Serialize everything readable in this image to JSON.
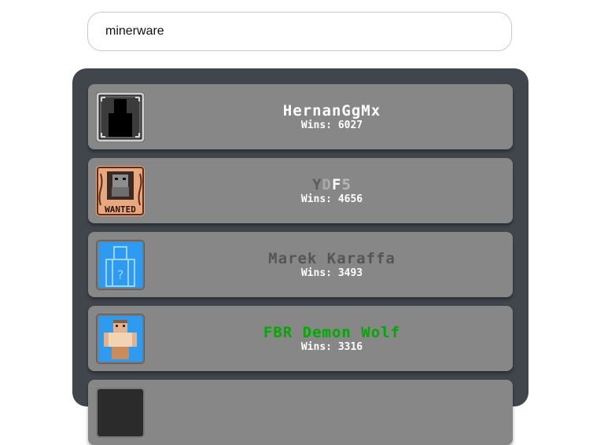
{
  "search": {
    "value": "minerware"
  },
  "players": [
    {
      "name": "HernanGgMx",
      "wins_label": "Wins: 6027",
      "name_color": "#ffffff",
      "avatar": "dark-frame-icon"
    },
    {
      "name_parts": [
        {
          "text": "Y",
          "color": "#5b5b5b"
        },
        {
          "text": "D",
          "color": "#aaaaaa"
        },
        {
          "text": "F",
          "color": "#ffffff"
        },
        {
          "text": "5",
          "color": "#b8b8b8"
        }
      ],
      "wins_label": "Wins: 4656",
      "avatar": "wanted-poster-icon"
    },
    {
      "name": "Marek Karaffa",
      "wins_label": "Wins: 3493",
      "name_color": "#555555",
      "avatar": "mystery-figure-icon"
    },
    {
      "name": "FBR Demon Wolf",
      "wins_label": "Wins: 3316",
      "name_color": "#00aa00",
      "avatar": "player-skin-icon"
    }
  ],
  "avatar_text": {
    "wanted": "WANTED",
    "mystery": "?"
  },
  "colors": {
    "panel": "#41464d",
    "row": "#878787"
  }
}
